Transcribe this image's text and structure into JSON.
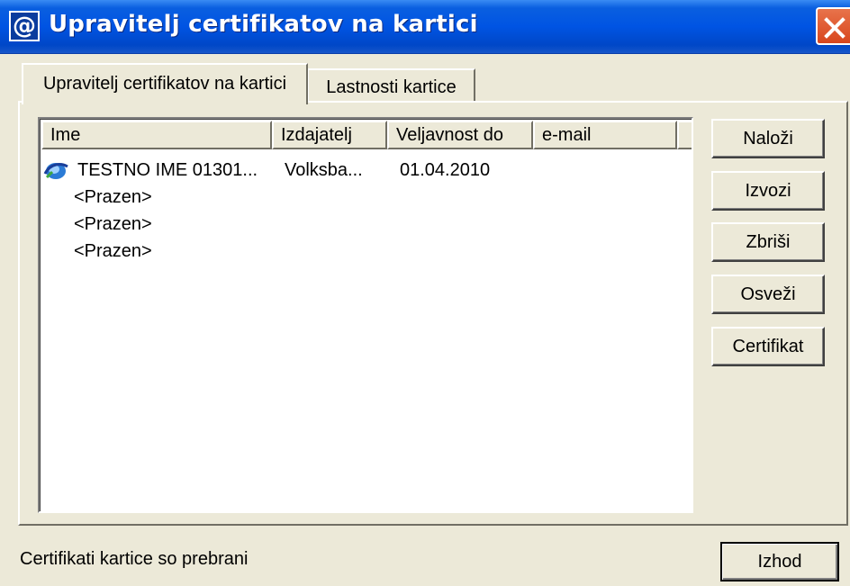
{
  "window": {
    "title": "Upravitelj certifikatov na kartici",
    "icon": "at-sign-icon"
  },
  "tabs": [
    {
      "label": "Upravitelj certifikatov na kartici",
      "active": true
    },
    {
      "label": "Lastnosti kartice",
      "active": false
    }
  ],
  "list": {
    "columns": [
      "Ime",
      "Izdajatelj",
      "Veljavnost do",
      "e-mail"
    ],
    "rows": [
      {
        "name": "TESTNO IME 01301...",
        "issuer": "Volksba...",
        "valid_until": "01.04.2010",
        "email": "",
        "icon": "certificate-icon"
      },
      {
        "name": "<Prazen>",
        "issuer": "",
        "valid_until": "",
        "email": ""
      },
      {
        "name": "<Prazen>",
        "issuer": "",
        "valid_until": "",
        "email": ""
      },
      {
        "name": "<Prazen>",
        "issuer": "",
        "valid_until": "",
        "email": ""
      }
    ]
  },
  "buttons": {
    "load": "Naloži",
    "export": "Izvozi",
    "delete": "Zbriši",
    "refresh": "Osveži",
    "certificate": "Certifikat",
    "exit": "Izhod"
  },
  "status_text": "Certifikati kartice so prebrani",
  "colors": {
    "titlebar": "#0054e3",
    "face": "#ece9d8",
    "close": "#d8461d"
  }
}
